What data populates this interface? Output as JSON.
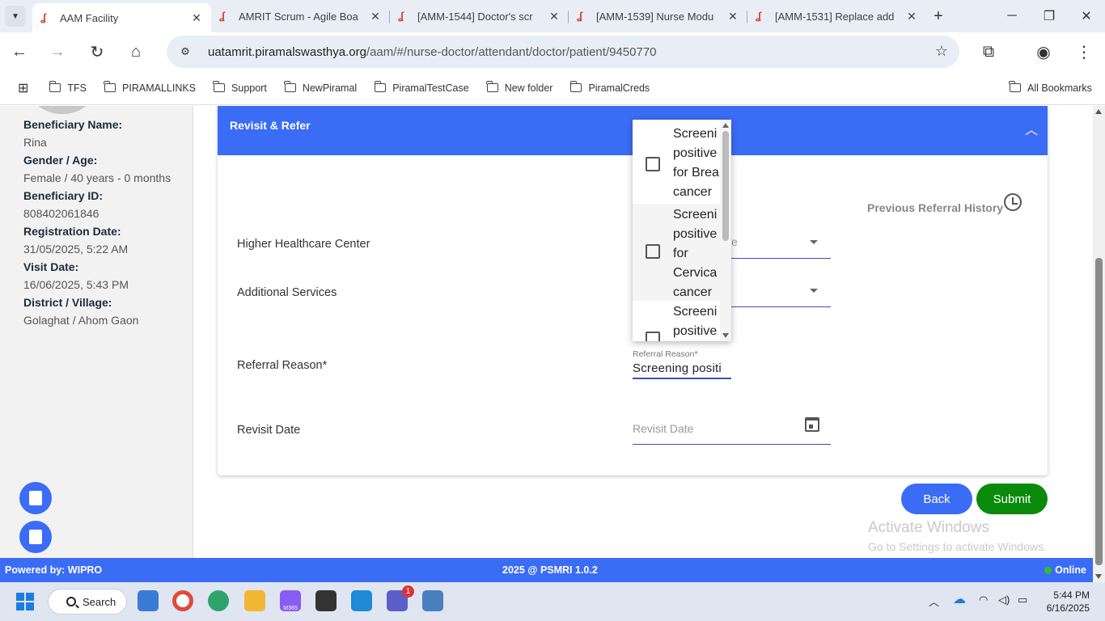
{
  "browser": {
    "tabs": [
      {
        "label": "AAM Facility",
        "active": true
      },
      {
        "label": "AMRIT Scrum - Agile Boa",
        "active": false
      },
      {
        "label": "[AMM-1544] Doctor's scr",
        "active": false
      },
      {
        "label": "[AMM-1539] Nurse Modu",
        "active": false
      },
      {
        "label": "[AMM-1531] Replace add",
        "active": false
      }
    ],
    "url_host": "uatamrit.piramalswasthya.org",
    "url_path": "/aam/#/nurse-doctor/attendant/doctor/patient/9450770",
    "bookmarks": [
      "TFS",
      "PIRAMALLINKS",
      "Support",
      "NewPiramal",
      "PiramalTestCase",
      "New folder",
      "PiramalCreds"
    ],
    "all_bookmarks": "All Bookmarks"
  },
  "beneficiary": {
    "name_label": "Beneficiary Name:",
    "name": "Rina",
    "gender_age_label": "Gender / Age:",
    "gender_age": "Female / 40 years - 0 months",
    "id_label": "Beneficiary ID:",
    "id": "808402061846",
    "reg_date_label": "Registration Date:",
    "reg_date": "31/05/2025, 5:22 AM",
    "visit_date_label": "Visit Date:",
    "visit_date": "16/06/2025, 5:43 PM",
    "district_label": "District / Village:",
    "district": "Golaghat / Ahom Gaon"
  },
  "card": {
    "title": "Revisit & Refer",
    "previous_referral": "Previous Referral History",
    "higher_healthcare_label": "Higher Healthcare Center",
    "higher_healthcare_placeholder": "e",
    "additional_services_label": "Additional Services",
    "referral_reason_label": "Referral Reason*",
    "referral_reason_float": "Referral Reason",
    "referral_reason_value": "Screening positi",
    "revisit_label": "Revisit Date",
    "revisit_placeholder": "Revisit Date"
  },
  "dropdown": {
    "options": [
      {
        "text": "Screeni\npositive\nfor Brea\ncancer",
        "checked": false
      },
      {
        "text": "Screeni\npositive\nfor\nCervica\ncancer",
        "checked": false
      },
      {
        "text": "Screeni\npositive",
        "checked": false
      }
    ]
  },
  "actions": {
    "back": "Back",
    "submit": "Submit"
  },
  "watermark": {
    "line1": "Activate Windows",
    "line2": "Go to Settings to activate Windows."
  },
  "footer": {
    "left": "Powered by: WIPRO",
    "center": "2025 @ PSMRI 1.0.2",
    "right": "Online"
  },
  "taskbar": {
    "search": "Search",
    "time": "5:44 PM",
    "date": "6/16/2025",
    "teams_badge": "1",
    "m365_label": "M365"
  },
  "colors": {
    "primary": "#3b6cf6",
    "submit": "#0a8a0a",
    "online": "#2ec02e"
  }
}
